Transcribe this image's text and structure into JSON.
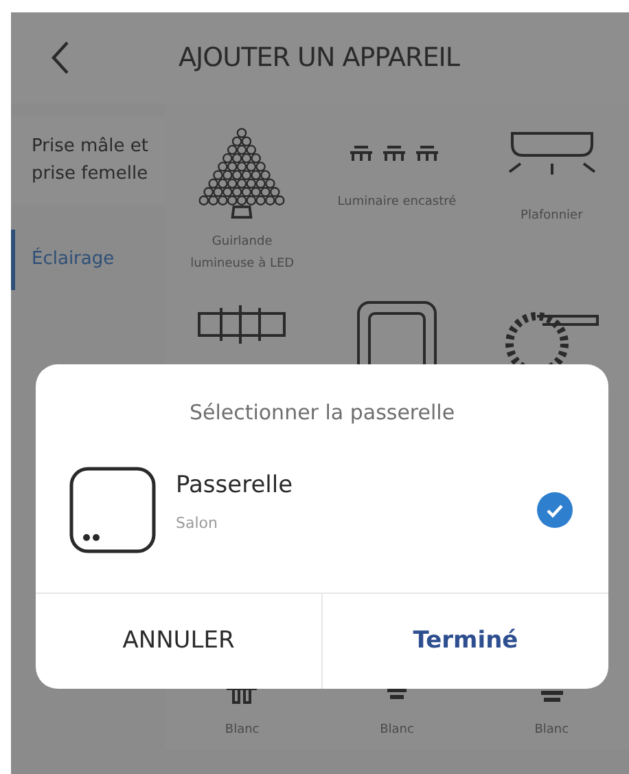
{
  "header": {
    "title": "AJOUTER UN APPAREIL"
  },
  "sidebar": {
    "items": [
      {
        "label": "Prise mâle et prise femelle",
        "selected": false
      },
      {
        "label": "Éclairage",
        "selected": true
      }
    ]
  },
  "devices": [
    {
      "kind": "tree",
      "label": "Guirlande lumineuse à LED"
    },
    {
      "kind": "spots",
      "label": "Luminaire encastré"
    },
    {
      "kind": "ceiling",
      "label": "Plafonnier"
    },
    {
      "kind": "rope"
    },
    {
      "kind": "panel"
    },
    {
      "kind": "strip"
    },
    {
      "kind": "gu10",
      "label": "Blanc"
    },
    {
      "kind": "candle",
      "label": "Blanc"
    },
    {
      "kind": "bulb",
      "label": "Blanc"
    }
  ],
  "dialog": {
    "title": "Sélectionner la passerelle",
    "gateways": [
      {
        "name": "Passerelle",
        "room": "Salon",
        "selected": true
      }
    ],
    "buttons": [
      {
        "kind": "cancel",
        "label": "ANNULER"
      },
      {
        "kind": "confirm",
        "label": "Terminé"
      }
    ]
  }
}
